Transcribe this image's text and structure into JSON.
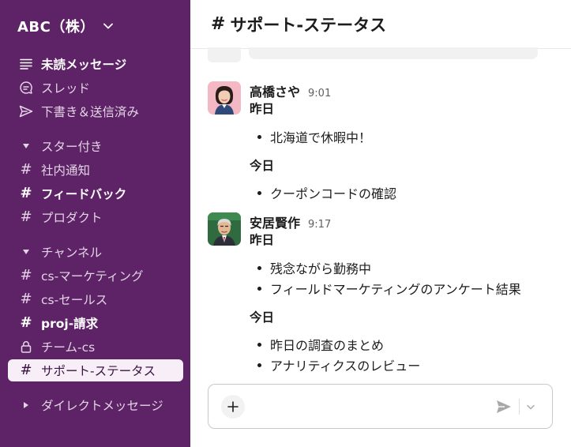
{
  "workspace": {
    "name": "ABC（株）"
  },
  "sidebar": {
    "top_items": [
      {
        "label": "未読メッセージ",
        "icon": "unreads-icon",
        "bold": true
      },
      {
        "label": "スレッド",
        "icon": "threads-icon",
        "bold": false
      },
      {
        "label": "下書き＆送信済み",
        "icon": "send-icon",
        "bold": false
      }
    ],
    "starred": {
      "label": "スター付き",
      "channels": [
        {
          "label": "社内通知",
          "bold": false
        },
        {
          "label": "フィードバック",
          "bold": true
        },
        {
          "label": "プロダクト",
          "bold": false
        }
      ]
    },
    "channels": {
      "label": "チャンネル",
      "items": [
        {
          "label": "cs-マーケティング",
          "icon": "hash-icon",
          "bold": false
        },
        {
          "label": "cs-セールス",
          "icon": "hash-icon",
          "bold": false
        },
        {
          "label": "proj-請求",
          "icon": "hash-icon",
          "bold": true
        },
        {
          "label": "チーム-cs",
          "icon": "lock-icon",
          "bold": false
        },
        {
          "label": "サポート-ステータス",
          "icon": "hash-icon",
          "bold": false,
          "active": true
        }
      ]
    },
    "dms": {
      "label": "ダイレクトメッセージ"
    },
    "hash_symbol": "#"
  },
  "main": {
    "channel_title": "サポート-ステータス",
    "hash_symbol": "#",
    "messages": [
      {
        "author": "高橋さや",
        "time": "9:01",
        "groups": [
          {
            "day": "昨日",
            "items": [
              "北海道で休暇中！"
            ]
          },
          {
            "day": "今日",
            "items": [
              "クーポンコードの確認"
            ]
          }
        ]
      },
      {
        "author": "安居賢作",
        "time": "9:17",
        "groups": [
          {
            "day": "昨日",
            "items": [
              "残念ながら勤務中",
              "フィールドマーケティングのアンケート結果"
            ]
          },
          {
            "day": "今日",
            "items": [
              "昨日の調査のまとめ",
              "アナリティクスのレビュー"
            ]
          }
        ]
      }
    ],
    "composer": {
      "placeholder": ""
    }
  },
  "colors": {
    "sidebar_bg": "#5e2366",
    "active_item_bg": "#f7eef8",
    "active_item_text": "#3a1340"
  }
}
